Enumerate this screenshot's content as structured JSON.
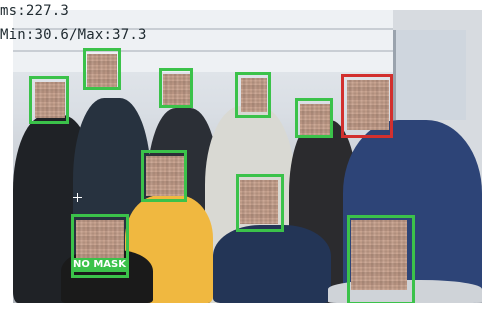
{
  "overlay": {
    "ms_text": "ms:227.3",
    "minmax_text": "Min:30.6/Max:37.3",
    "label_text": "NO MASK"
  },
  "colors": {
    "box_ok": "#3bc24a",
    "box_alert": "#d2302e"
  }
}
